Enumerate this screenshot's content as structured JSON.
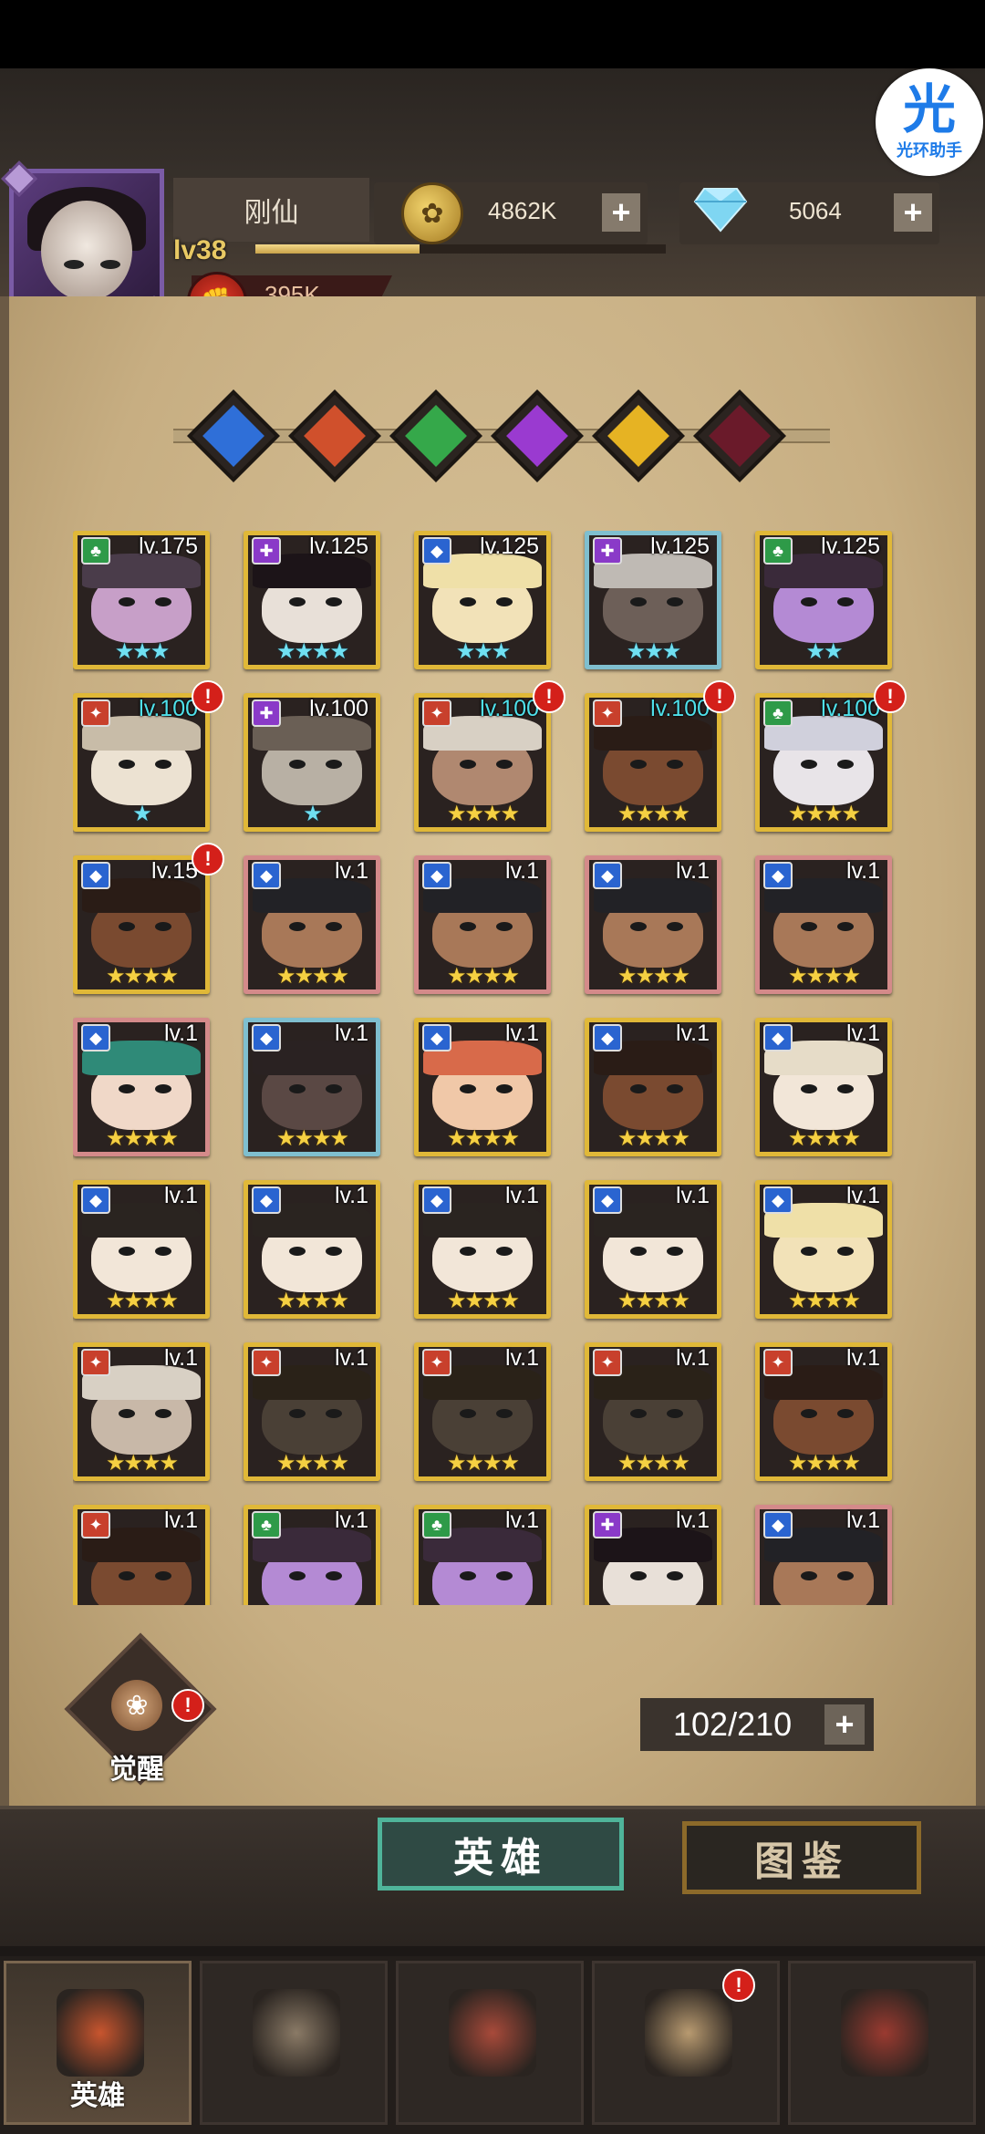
{
  "assistant": {
    "glyph": "光",
    "label": "光环助手"
  },
  "player": {
    "name": "刚仙",
    "level": "lv38",
    "exp_fraction": 0.4,
    "power": "395K"
  },
  "resources": {
    "gold": "4862K",
    "diamonds": "5064",
    "plus": "+"
  },
  "filters": [
    {
      "name": "filter-blue-icon",
      "color": "#2f6fd8"
    },
    {
      "name": "filter-red-icon",
      "color": "#d0502c"
    },
    {
      "name": "filter-green-icon",
      "color": "#35a84a"
    },
    {
      "name": "filter-purple-icon",
      "color": "#9a3ad0"
    },
    {
      "name": "filter-yellow-icon",
      "color": "#e6b323"
    },
    {
      "name": "filter-crimson-icon",
      "color": "#6a1a2a"
    }
  ],
  "heroes": [
    {
      "level": "lv.175",
      "stars": "★★★",
      "star_color": "cyan",
      "cls": "green",
      "border": "gold",
      "alert": false,
      "lvcolor": "white",
      "skin": "#c79fc8",
      "hat": "#4a3c4a"
    },
    {
      "level": "lv.125",
      "stars": "★★★★",
      "star_color": "cyan",
      "cls": "purple",
      "border": "gold",
      "alert": false,
      "lvcolor": "white",
      "skin": "#e8e0d8",
      "hat": "#1c1418"
    },
    {
      "level": "lv.125",
      "stars": "★★★",
      "star_color": "cyan",
      "cls": "blue",
      "border": "gold",
      "alert": false,
      "lvcolor": "white",
      "skin": "#f2e2b8",
      "hat": "#efe0a8"
    },
    {
      "level": "lv.125",
      "stars": "★★★",
      "star_color": "cyan",
      "cls": "purple",
      "border": "teal",
      "alert": false,
      "lvcolor": "white",
      "skin": "#6d5f58",
      "hat": "#bfbab4"
    },
    {
      "level": "lv.125",
      "stars": "★★",
      "star_color": "cyan",
      "cls": "green",
      "border": "gold",
      "alert": false,
      "lvcolor": "white",
      "skin": "#b48ad4",
      "hat": "#3a2a3a"
    },
    {
      "level": "lv.100",
      "stars": "★",
      "star_color": "cyan",
      "cls": "red",
      "border": "gold",
      "alert": true,
      "lvcolor": "cyan",
      "skin": "#ece2d2",
      "hat": "#c8bca8"
    },
    {
      "level": "lv.100",
      "stars": "★",
      "star_color": "cyan",
      "cls": "purple",
      "border": "gold",
      "alert": false,
      "lvcolor": "white",
      "skin": "#b8b0a4",
      "hat": "#6a5f55"
    },
    {
      "level": "lv.100",
      "stars": "★★★★",
      "star_color": "gold",
      "cls": "red",
      "border": "gold",
      "alert": true,
      "lvcolor": "cyan",
      "skin": "#b08870",
      "hat": "#d8d0c4"
    },
    {
      "level": "lv.100",
      "stars": "★★★★",
      "star_color": "gold",
      "cls": "red",
      "border": "gold",
      "alert": true,
      "lvcolor": "cyan",
      "skin": "#7a4a30",
      "hat": "#2a1c16"
    },
    {
      "level": "lv.100",
      "stars": "★★★★",
      "star_color": "gold",
      "cls": "green",
      "border": "gold",
      "alert": true,
      "lvcolor": "cyan",
      "skin": "#e8e4e8",
      "hat": "#d0d0dc"
    },
    {
      "level": "lv.15",
      "stars": "★★★★",
      "star_color": "gold",
      "cls": "blue",
      "border": "gold",
      "alert": true,
      "lvcolor": "white",
      "skin": "#7a4a30",
      "hat": "#2a1c16"
    },
    {
      "level": "lv.1",
      "stars": "★★★★",
      "star_color": "gold",
      "cls": "blue",
      "border": "pink",
      "alert": false,
      "lvcolor": "white",
      "skin": "#a87858",
      "hat": "#222226"
    },
    {
      "level": "lv.1",
      "stars": "★★★★",
      "star_color": "gold",
      "cls": "blue",
      "border": "pink",
      "alert": false,
      "lvcolor": "white",
      "skin": "#a87858",
      "hat": "#222226"
    },
    {
      "level": "lv.1",
      "stars": "★★★★",
      "star_color": "gold",
      "cls": "blue",
      "border": "pink",
      "alert": false,
      "lvcolor": "white",
      "skin": "#a87858",
      "hat": "#222226"
    },
    {
      "level": "lv.1",
      "stars": "★★★★",
      "star_color": "gold",
      "cls": "blue",
      "border": "pink",
      "alert": false,
      "lvcolor": "white",
      "skin": "#a87858",
      "hat": "#222226"
    },
    {
      "level": "lv.1",
      "stars": "★★★★",
      "star_color": "gold",
      "cls": "blue",
      "border": "pink",
      "alert": false,
      "lvcolor": "white",
      "skin": "#f0d8c8",
      "hat": "#2f8a78"
    },
    {
      "level": "lv.1",
      "stars": "★★★★",
      "star_color": "gold",
      "cls": "blue",
      "border": "teal",
      "alert": false,
      "lvcolor": "white",
      "skin": "#5a4844",
      "hat": "#2a2222"
    },
    {
      "level": "lv.1",
      "stars": "★★★★",
      "star_color": "gold",
      "cls": "blue",
      "border": "gold",
      "alert": false,
      "lvcolor": "white",
      "skin": "#f0c8a8",
      "hat": "#d86a4a"
    },
    {
      "level": "lv.1",
      "stars": "★★★★",
      "star_color": "gold",
      "cls": "blue",
      "border": "gold",
      "alert": false,
      "lvcolor": "white",
      "skin": "#7a4a30",
      "hat": "#2a1c16"
    },
    {
      "level": "lv.1",
      "stars": "★★★★",
      "star_color": "gold",
      "cls": "blue",
      "border": "gold",
      "alert": false,
      "lvcolor": "white",
      "skin": "#f2e6d8",
      "hat": "#e6dcc8"
    },
    {
      "level": "lv.1",
      "stars": "★★★★",
      "star_color": "gold",
      "cls": "blue",
      "border": "gold",
      "alert": false,
      "lvcolor": "white",
      "skin": "#f2e6d8",
      "hat": "#2a2420"
    },
    {
      "level": "lv.1",
      "stars": "★★★★",
      "star_color": "gold",
      "cls": "blue",
      "border": "gold",
      "alert": false,
      "lvcolor": "white",
      "skin": "#f2e6d8",
      "hat": "#2a2420"
    },
    {
      "level": "lv.1",
      "stars": "★★★★",
      "star_color": "gold",
      "cls": "blue",
      "border": "gold",
      "alert": false,
      "lvcolor": "white",
      "skin": "#f2e6d8",
      "hat": "#2a2420"
    },
    {
      "level": "lv.1",
      "stars": "★★★★",
      "star_color": "gold",
      "cls": "blue",
      "border": "gold",
      "alert": false,
      "lvcolor": "white",
      "skin": "#f2e6d8",
      "hat": "#2a2420"
    },
    {
      "level": "lv.1",
      "stars": "★★★★",
      "star_color": "gold",
      "cls": "blue",
      "border": "gold",
      "alert": false,
      "lvcolor": "white",
      "skin": "#f2e2b8",
      "hat": "#efe0a8"
    },
    {
      "level": "lv.1",
      "stars": "★★★★",
      "star_color": "gold",
      "cls": "red",
      "border": "gold",
      "alert": false,
      "lvcolor": "white",
      "skin": "#c8b8a8",
      "hat": "#d8d0c4"
    },
    {
      "level": "lv.1",
      "stars": "★★★★",
      "star_color": "gold",
      "cls": "red",
      "border": "gold",
      "alert": false,
      "lvcolor": "white",
      "skin": "#4a4036",
      "hat": "#2a2218"
    },
    {
      "level": "lv.1",
      "stars": "★★★★",
      "star_color": "gold",
      "cls": "red",
      "border": "gold",
      "alert": false,
      "lvcolor": "white",
      "skin": "#4a4036",
      "hat": "#2a2218"
    },
    {
      "level": "lv.1",
      "stars": "★★★★",
      "star_color": "gold",
      "cls": "red",
      "border": "gold",
      "alert": false,
      "lvcolor": "white",
      "skin": "#4a4036",
      "hat": "#2a2218"
    },
    {
      "level": "lv.1",
      "stars": "★★★★",
      "star_color": "gold",
      "cls": "red",
      "border": "gold",
      "alert": false,
      "lvcolor": "white",
      "skin": "#7a4a30",
      "hat": "#2a1c16"
    },
    {
      "level": "lv.1",
      "stars": "",
      "star_color": "gold",
      "cls": "red",
      "border": "gold",
      "alert": false,
      "lvcolor": "white",
      "skin": "#7a4a30",
      "hat": "#2a1c16"
    },
    {
      "level": "lv.1",
      "stars": "",
      "star_color": "gold",
      "cls": "green",
      "border": "gold",
      "alert": false,
      "lvcolor": "white",
      "skin": "#b48ad4",
      "hat": "#3a2a3a"
    },
    {
      "level": "lv.1",
      "stars": "",
      "star_color": "gold",
      "cls": "green",
      "border": "gold",
      "alert": false,
      "lvcolor": "white",
      "skin": "#b48ad4",
      "hat": "#3a2a3a"
    },
    {
      "level": "lv.1",
      "stars": "",
      "star_color": "gold",
      "cls": "purple",
      "border": "gold",
      "alert": false,
      "lvcolor": "white",
      "skin": "#e8e0d8",
      "hat": "#1c1418"
    },
    {
      "level": "lv.1",
      "stars": "",
      "star_color": "gold",
      "cls": "blue",
      "border": "pink",
      "alert": false,
      "lvcolor": "white",
      "skin": "#a87858",
      "hat": "#222226"
    }
  ],
  "class_colors": {
    "green": "#2e9a48",
    "purple": "#8a3ac8",
    "blue": "#2a64d0",
    "red": "#c8402c"
  },
  "awaken": {
    "label": "觉醒",
    "alert": "!"
  },
  "hero_count": {
    "value": "102/210"
  },
  "subtabs": {
    "heroes": "英雄",
    "codex": "图鉴"
  },
  "nav": [
    {
      "name": "nav-heroes",
      "label": "英雄",
      "active": true,
      "color": "#c8552e"
    },
    {
      "name": "nav-adventure",
      "label": "",
      "active": false,
      "color": "#8a7a66"
    },
    {
      "name": "nav-battle",
      "label": "",
      "active": false,
      "color": "#a84a3a"
    },
    {
      "name": "nav-castle",
      "label": "",
      "active": false,
      "color": "#b89a70",
      "alert": true
    },
    {
      "name": "nav-guild",
      "label": "",
      "active": false,
      "color": "#9a3a30"
    }
  ],
  "alert_mark": "!"
}
